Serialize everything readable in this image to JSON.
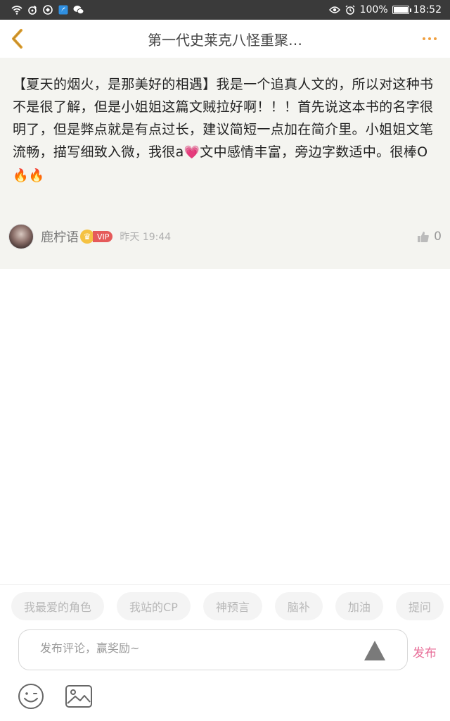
{
  "status_bar": {
    "battery": "100%",
    "time": "18:52",
    "battery_level": 1.0
  },
  "header": {
    "title": "第一代史莱克八怪重聚…"
  },
  "comment": {
    "text_before": "【夏天的烟火，是那美好的相遇】我是一个追真人文的，所以对这种书不是很了解，但是小姐姐这篇文贼拉好啊！！！首先说这本书的名字很明了，但是弊点就是有点过长，建议简短一点加在简介里。小姐姐文笔流畅，描写细致入微，我很a",
    "emoji_heart": "💗",
    "text_middle": "文中感情丰富，旁边字数适中。很棒O",
    "emoji_fire": "🔥🔥",
    "author": "鹿柠语",
    "vip_label": "VIP",
    "time": "昨天 19:44",
    "likes": "0"
  },
  "chips": [
    "我最爱的角色",
    "我站的CP",
    "神预言",
    "脑补",
    "加油",
    "提问"
  ],
  "input": {
    "placeholder": "发布评论，赢奖励~",
    "value": ""
  },
  "publish_label": "发布",
  "colors": {
    "accent_back": "#e0a030",
    "accent_publish": "#e8709a",
    "card_bg": "#f4f4f0"
  }
}
